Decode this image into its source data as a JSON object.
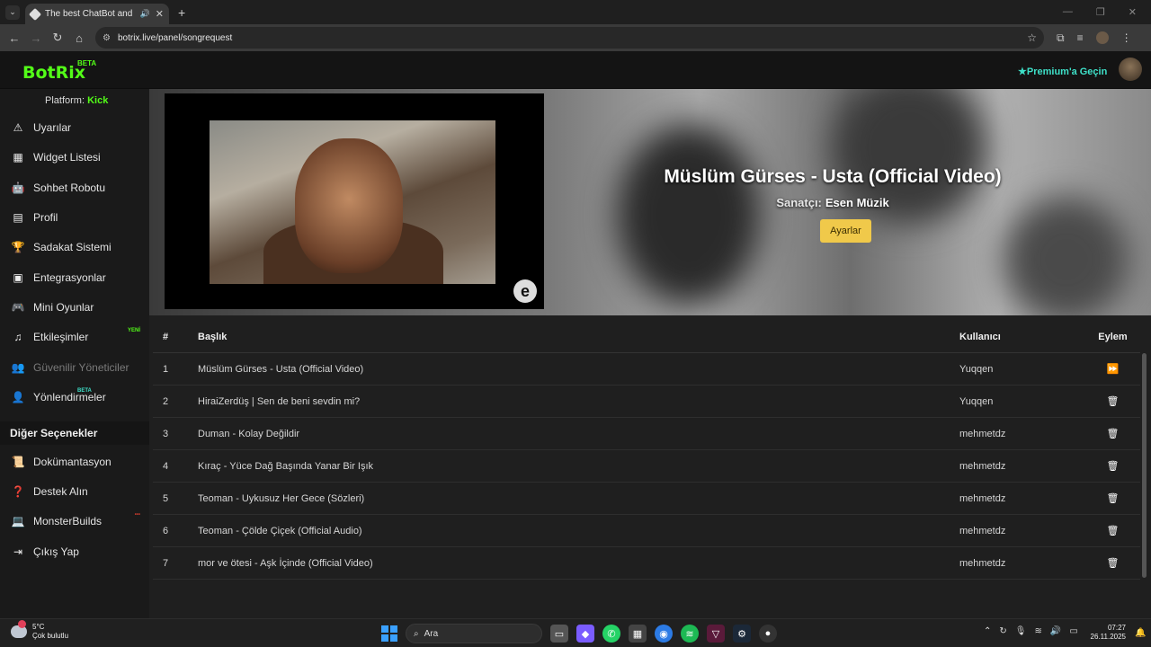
{
  "browser": {
    "tab_title": "The best ChatBot and Widg",
    "url": "botrix.live/panel/songrequest"
  },
  "header": {
    "logo": "BotRix",
    "logo_badge": "BETA",
    "premium": "Premium'a Geçin"
  },
  "sidebar": {
    "platform_label": "Platform:",
    "platform_value": "Kick",
    "items": [
      {
        "label": "Uyarılar",
        "icon": "warning-icon"
      },
      {
        "label": "Widget Listesi",
        "icon": "grid-icon"
      },
      {
        "label": "Sohbet Robotu",
        "icon": "robot-icon"
      },
      {
        "label": "Profil",
        "icon": "id-card-icon"
      },
      {
        "label": "Sadakat Sistemi",
        "icon": "trophy-icon"
      },
      {
        "label": "Entegrasyonlar",
        "icon": "plug-icon"
      },
      {
        "label": "Mini Oyunlar",
        "icon": "gamepad-icon"
      },
      {
        "label": "Etkileşimler",
        "icon": "music-icon",
        "badge": "YENİ"
      },
      {
        "label": "Güvenilir Yöneticiler",
        "icon": "users-icon",
        "disabled": true
      },
      {
        "label": "Yönlendirmeler",
        "icon": "user-group-icon",
        "badge": "BETA"
      }
    ],
    "other_heading": "Diğer Seçenekler",
    "other_items": [
      {
        "label": "Dokümantasyon",
        "icon": "scroll-icon"
      },
      {
        "label": "Destek Alın",
        "icon": "question-icon"
      },
      {
        "label": "MonsterBuilds",
        "icon": "laptop-icon",
        "badge": "•••"
      },
      {
        "label": "Çıkış Yap",
        "icon": "logout-icon"
      }
    ]
  },
  "now_playing": {
    "title": "Müslüm Gürses - Usta (Official Video)",
    "artist_label": "Sanatçı:",
    "artist": "Esen Müzik",
    "settings_button": "Ayarlar"
  },
  "queue": {
    "headers": {
      "num": "#",
      "title": "Başlık",
      "user": "Kullanıcı",
      "action": "Eylem"
    },
    "rows": [
      {
        "num": "1",
        "title": "Müslüm Gürses - Usta (Official Video)",
        "user": "Yuqqen",
        "action": "skip-icon"
      },
      {
        "num": "2",
        "title": "HiraiZerdüş | Sen de beni sevdin mi?",
        "user": "Yuqqen",
        "action": "trash-icon"
      },
      {
        "num": "3",
        "title": "Duman - Kolay Değildir",
        "user": "mehmetdz",
        "action": "trash-icon"
      },
      {
        "num": "4",
        "title": "Kıraç - Yüce Dağ Başında Yanar Bir Işık",
        "user": "mehmetdz",
        "action": "trash-icon"
      },
      {
        "num": "5",
        "title": "Teoman - Uykusuz Her Gece (Sözleri)",
        "user": "mehmetdz",
        "action": "trash-icon"
      },
      {
        "num": "6",
        "title": "Teoman - Çölde Çiçek (Official Audio)",
        "user": "mehmetdz",
        "action": "trash-icon"
      },
      {
        "num": "7",
        "title": "mor ve ötesi - Aşk İçinde (Official Video)",
        "user": "mehmetdz",
        "action": "trash-icon"
      }
    ]
  },
  "taskbar": {
    "temp": "5°C",
    "weather": "Çok bulutlu",
    "search": "Ara",
    "time": "07:27",
    "date": "26.11.2025"
  }
}
